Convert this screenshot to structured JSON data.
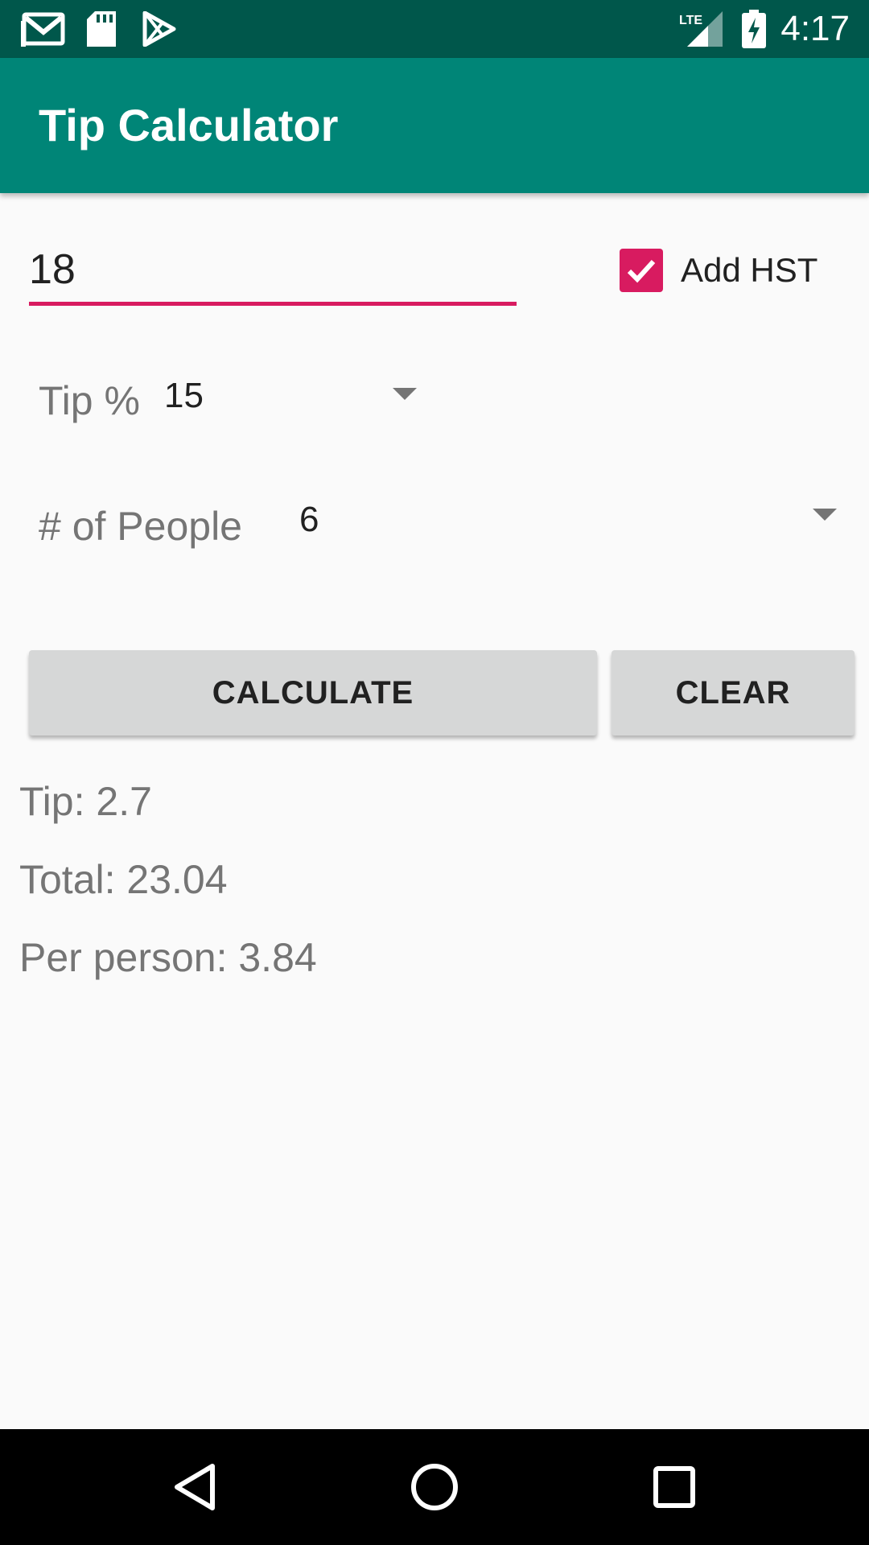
{
  "status_bar": {
    "time": "4:17",
    "network": "LTE",
    "icons": [
      "gmail-icon",
      "sd-card-icon",
      "play-store-icon",
      "lte-signal-icon",
      "battery-charging-icon"
    ]
  },
  "app_bar": {
    "title": "Tip Calculator",
    "color": "#008577"
  },
  "form": {
    "bill_value": "18",
    "hst_checkbox": {
      "label": "Add HST",
      "checked": true
    },
    "tip": {
      "label": "Tip %",
      "selected": "15"
    },
    "people": {
      "label": "# of People",
      "selected": "6"
    }
  },
  "buttons": {
    "calculate": "CALCULATE",
    "clear": "CLEAR"
  },
  "results": {
    "tip": "Tip: 2.7",
    "total": "Total: 23.04",
    "per_person": "Per person: 3.84"
  },
  "nav_bar": {
    "icons": [
      "back-icon",
      "home-icon",
      "recents-icon"
    ]
  },
  "colors": {
    "accent": "#d81b60",
    "status_bar": "#00574b",
    "button": "#d6d7d7"
  }
}
